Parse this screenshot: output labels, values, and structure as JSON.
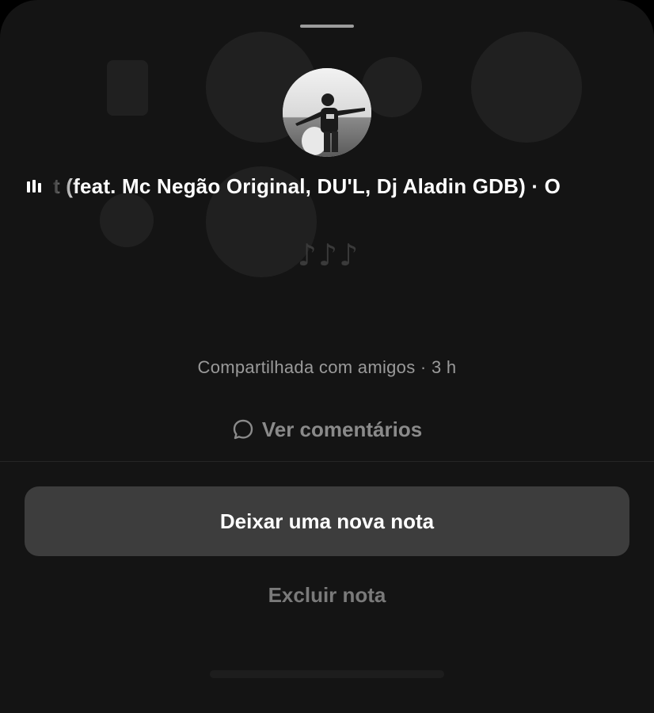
{
  "note": {
    "song_title": "t (feat. Mc Negão Original, DU'L, Dj Aladin GDB) · O",
    "music_notes": "♪♪♪",
    "shared_info": "Compartilhada com amigos · 3 h",
    "comments_label": "Ver comentários"
  },
  "actions": {
    "new_note_label": "Deixar uma nova nota",
    "delete_label": "Excluir nota"
  },
  "colors": {
    "sheet_background": "#141414",
    "primary_button": "#3d3d3d",
    "text_primary": "#ffffff",
    "text_secondary": "#9a9a9a"
  }
}
